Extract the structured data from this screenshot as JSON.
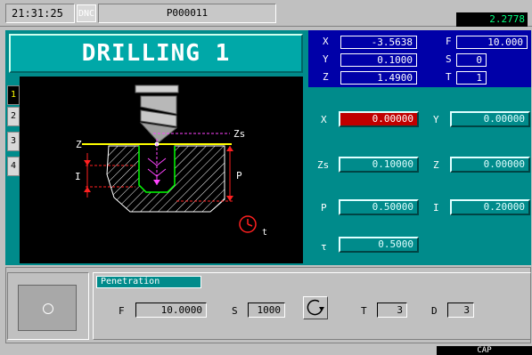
{
  "header": {
    "clock": "21:31:25",
    "mode_badge": "DNC",
    "program": "P000011",
    "feed_display": "2.2778"
  },
  "title": "DRILLING 1",
  "tabs": [
    "1",
    "2",
    "3",
    "4"
  ],
  "coords": {
    "x_label": "X",
    "x": "-3.5638",
    "y_label": "Y",
    "y": "0.1000",
    "z_label": "Z",
    "z": "1.4900",
    "f_label": "F",
    "f": "10.000",
    "s_label": "S",
    "s": "0",
    "t_label": "T",
    "t": "1"
  },
  "graphic": {
    "z_label": "Z",
    "zs_label": "Zs",
    "i_label": "I",
    "p_label": "P",
    "tau_label": "t"
  },
  "params": {
    "x_label": "X",
    "x": "0.00000",
    "y_label": "Y",
    "y": "0.00000",
    "zs_label": "Zs",
    "zs": "0.10000",
    "z_label": "Z",
    "z": "0.00000",
    "p_label": "P",
    "p": "0.50000",
    "i_label": "I",
    "i": "0.20000",
    "tau_label": "τ",
    "tau": "0.5000"
  },
  "bottom": {
    "penetration_label": "Penetration",
    "f_label": "F",
    "f": "10.0000",
    "s_label": "S",
    "s": "1000",
    "t_label": "T",
    "t": "3",
    "d_label": "D",
    "d": "3"
  },
  "status": {
    "cap": "CAP"
  },
  "colors": {
    "teal": "#008b8b",
    "blue_panel": "#0000a8",
    "active_field": "#c00000",
    "graphic_bg": "#000000"
  }
}
